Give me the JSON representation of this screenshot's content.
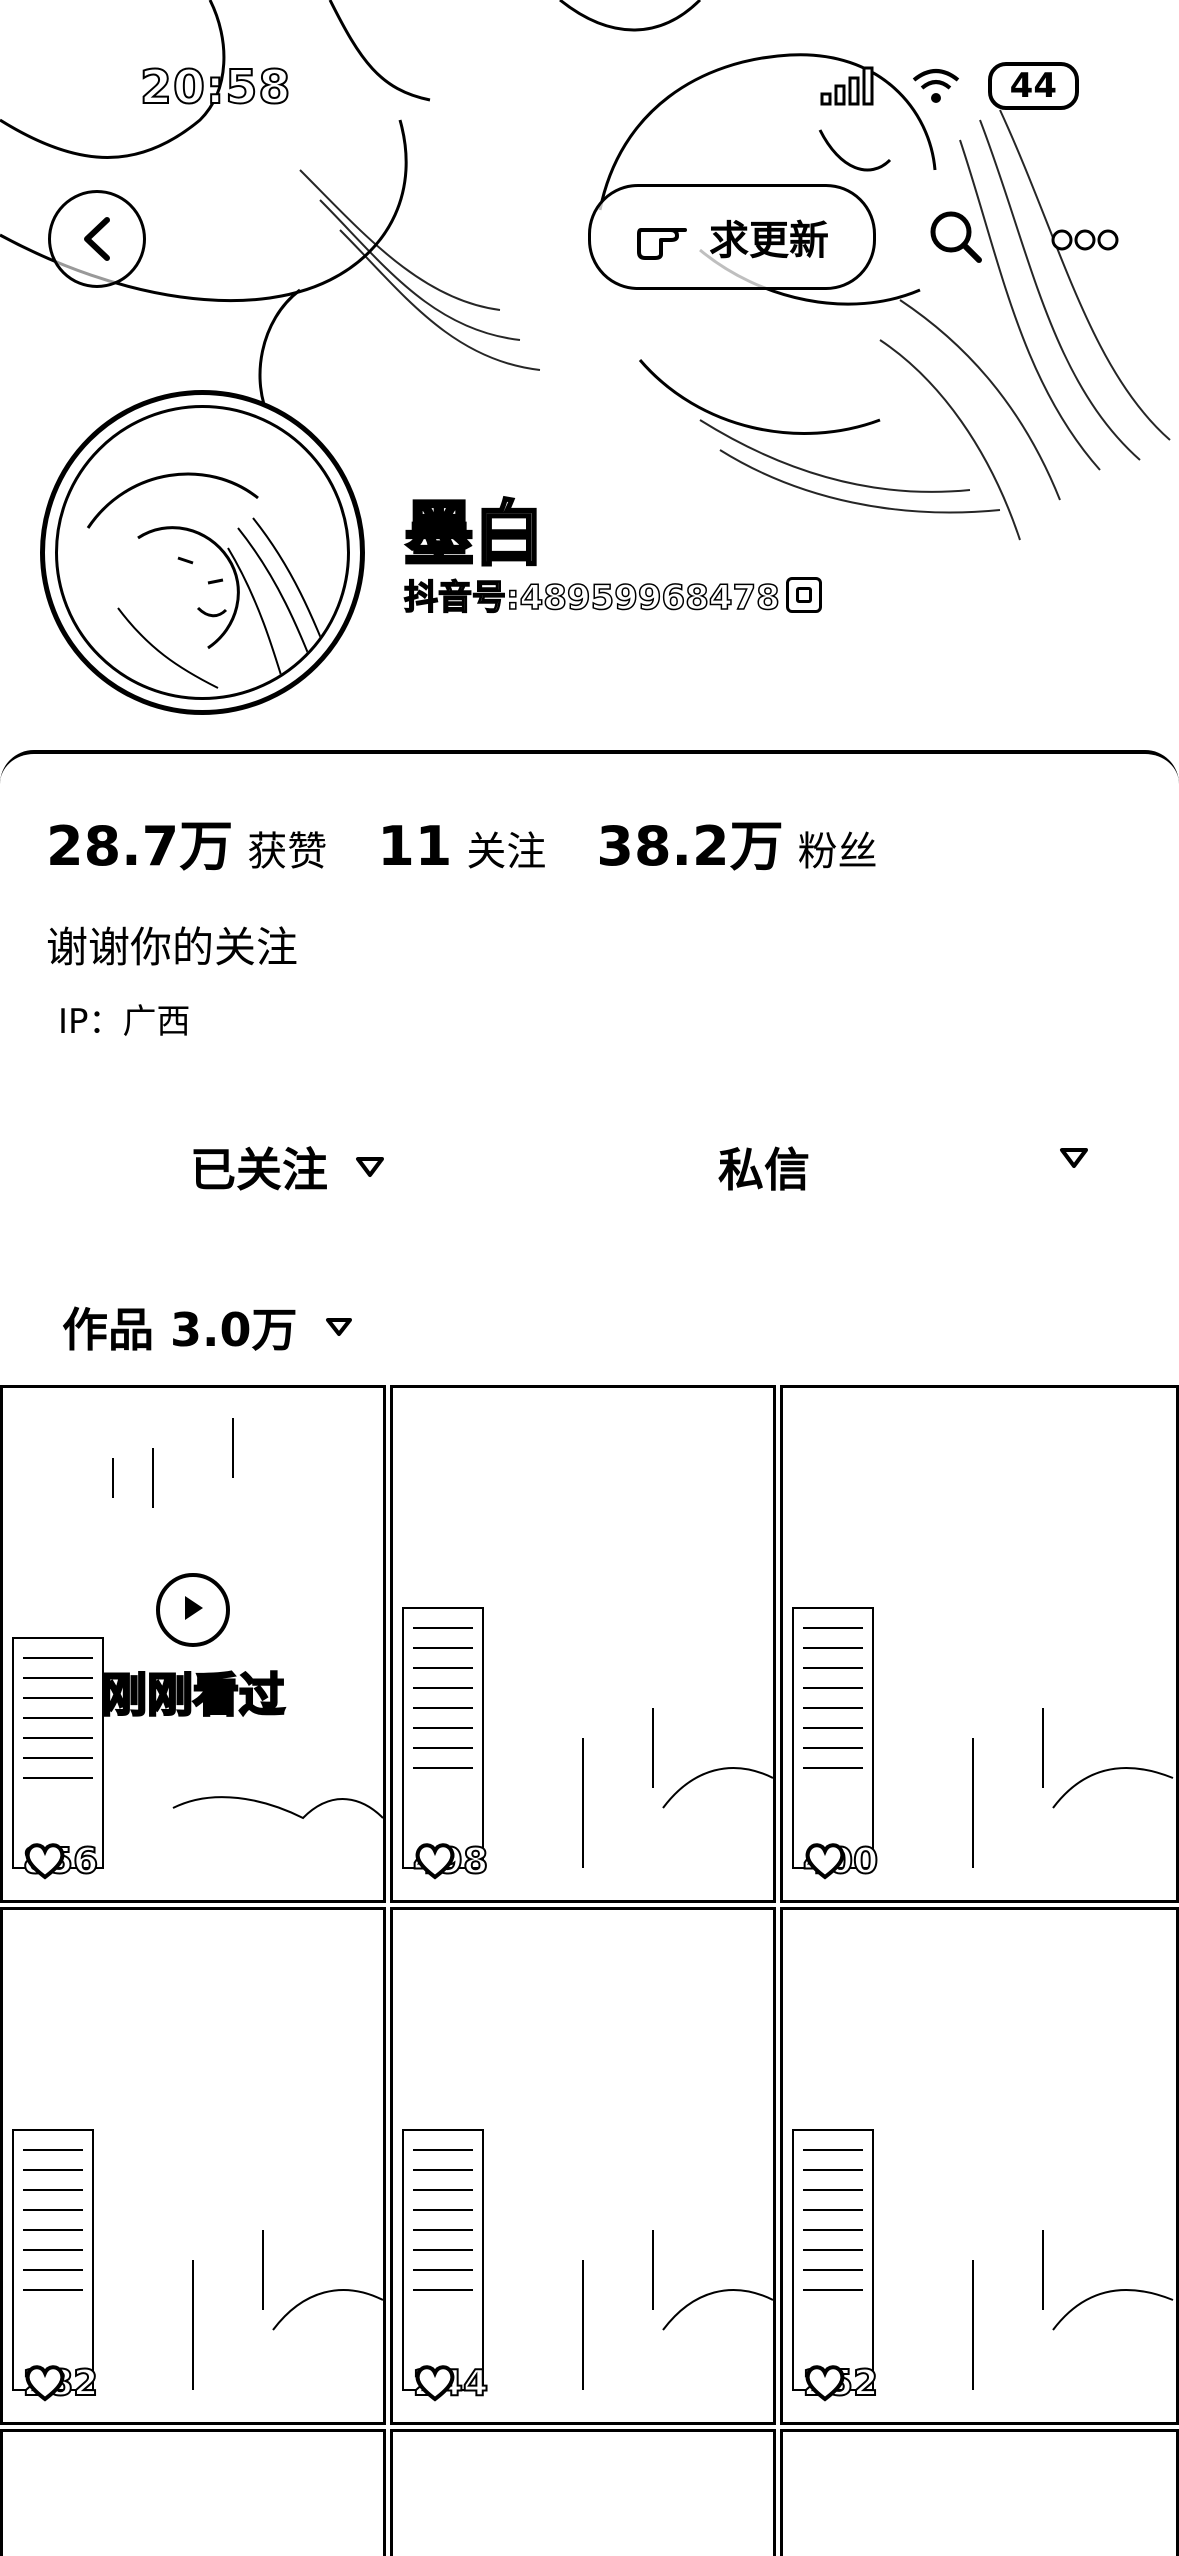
{
  "status_bar": {
    "time": "20:58",
    "battery": "44"
  },
  "header": {
    "request_update_label": "求更新"
  },
  "profile": {
    "name": "墨白",
    "douyin_id": "抖音号:48959968478"
  },
  "stats": [
    {
      "value": "28.7万",
      "label": "获赞"
    },
    {
      "value": "11",
      "label": "关注"
    },
    {
      "value": "38.2万",
      "label": "粉丝"
    }
  ],
  "bio": "谢谢你的关注",
  "ip": "IP：广西",
  "actions": {
    "follow_label": "已关注",
    "message_label": "私信"
  },
  "works_tab": {
    "label": "作品 3.0万"
  },
  "videos": [
    {
      "likes": "856",
      "seen_label": "刚刚看过"
    },
    {
      "likes": "498"
    },
    {
      "likes": "400"
    },
    {
      "likes": "282"
    },
    {
      "likes": "244"
    },
    {
      "likes": "252"
    }
  ]
}
